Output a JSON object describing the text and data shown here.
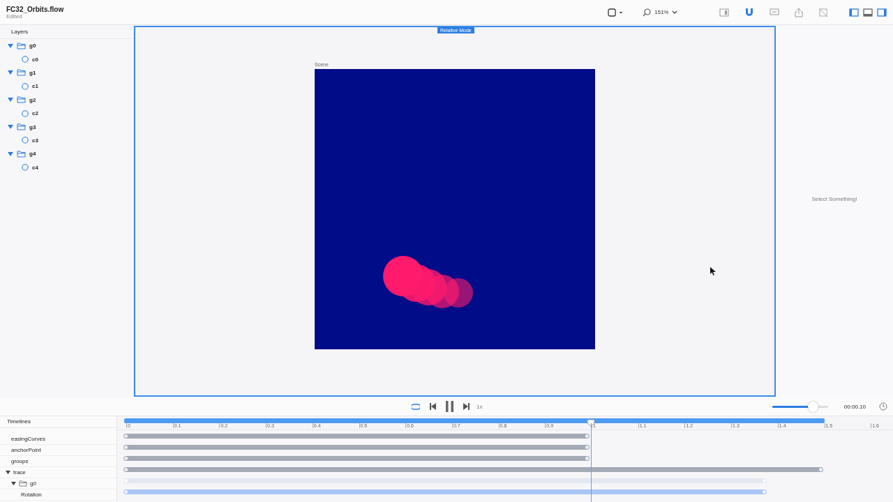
{
  "document": {
    "title": "FC32_Orbits.flow",
    "status": "Edited"
  },
  "toolbar": {
    "zoom": "151%"
  },
  "layers": {
    "title": "Layers",
    "items": [
      {
        "name": "g0",
        "expanded": true,
        "children": [
          {
            "name": "c0"
          }
        ]
      },
      {
        "name": "g1",
        "expanded": true,
        "children": [
          {
            "name": "c1"
          }
        ]
      },
      {
        "name": "g2",
        "expanded": true,
        "children": [
          {
            "name": "c2"
          }
        ]
      },
      {
        "name": "g3",
        "expanded": true,
        "children": [
          {
            "name": "c3"
          }
        ]
      },
      {
        "name": "g4",
        "expanded": true,
        "children": [
          {
            "name": "c4"
          }
        ]
      }
    ]
  },
  "canvas": {
    "mode_badge": "Relative Mode",
    "scene_label": "Scene"
  },
  "inspector": {
    "empty_text": "Select Something!"
  },
  "transport": {
    "speed": "1x",
    "volume": {
      "level": 0.75
    },
    "time": "00:00.10"
  },
  "timelines": {
    "title": "Timelines",
    "ruler": [
      "0",
      "0.1",
      "0.2",
      "0.3",
      "0.4",
      "0.5",
      "0.6",
      "0.7",
      "0.8",
      "0.9",
      "1",
      "1.1",
      "1.2",
      "1.3",
      "1.4",
      "1.5",
      "1.6"
    ],
    "rows": [
      {
        "label": "easingCurves",
        "kind": "dark"
      },
      {
        "label": "anchorPoint",
        "kind": "dark"
      },
      {
        "label": "groups",
        "kind": "dark"
      },
      {
        "label": "trace",
        "kind": "dark",
        "expanded": true
      },
      {
        "label": "g0",
        "kind": "light",
        "expanded": true
      },
      {
        "label": "Rotation",
        "kind": "blue"
      }
    ]
  }
}
